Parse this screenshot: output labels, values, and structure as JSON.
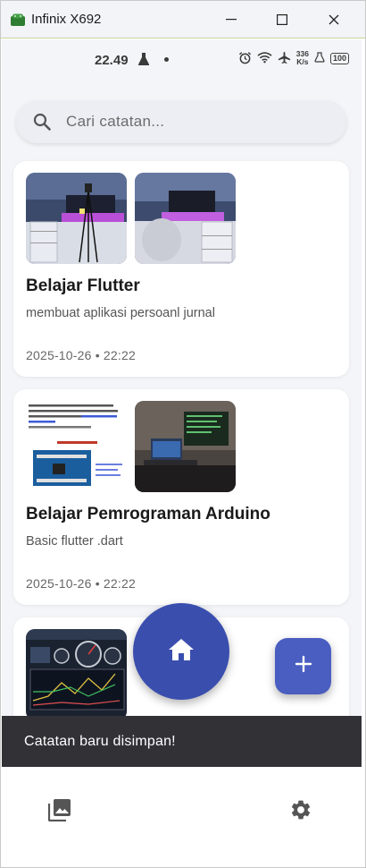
{
  "window": {
    "title": "Infinix X692",
    "icon": "android-icon"
  },
  "status_bar": {
    "time": "22.49",
    "icons": [
      "flask-icon",
      "dot",
      "alarm-icon",
      "wifi-icon",
      "airplane-icon"
    ],
    "speed_value": "336",
    "speed_unit": "K/s",
    "battery": "100"
  },
  "search": {
    "placeholder": "Cari catatan..."
  },
  "notes": [
    {
      "title": "Belajar Flutter",
      "description": "membuat aplikasi persoanl jurnal",
      "date": "2025-10-26 • 22:22",
      "images": [
        "desk-setup-photo",
        "desk-setup-photo"
      ]
    },
    {
      "title": "Belajar Pemrograman Arduino",
      "description": "Basic flutter .dart",
      "date": "2025-10-26 • 22:22",
      "images": [
        "arduino-post-image",
        "laptop-desk-photo"
      ]
    },
    {
      "title": "",
      "description": "",
      "date": "",
      "images": [
        "dashboard-gauges-image"
      ]
    }
  ],
  "fab": {
    "home_icon": "home-icon",
    "add_icon": "plus-icon"
  },
  "snackbar": {
    "message": "Catatan baru disimpan!"
  },
  "bottom_nav": {
    "left_icon": "gallery-icon",
    "right_icon": "settings-icon"
  },
  "colors": {
    "primary": "#3a4eae",
    "snackbar": "#323236",
    "background": "#f4f5f8"
  }
}
